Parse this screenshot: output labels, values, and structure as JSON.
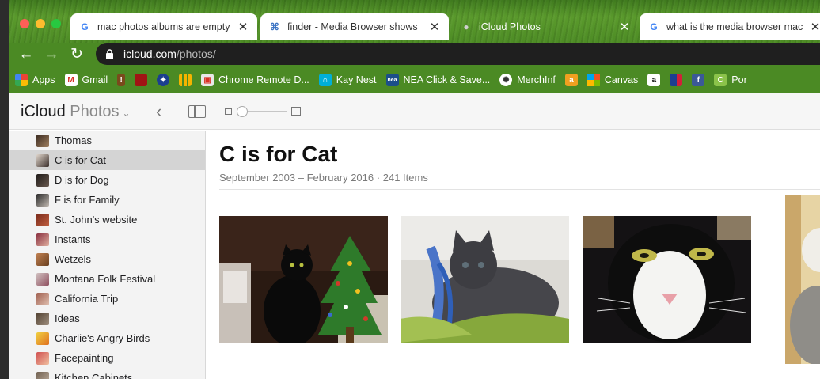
{
  "browser": {
    "tabs": [
      {
        "title": "mac photos albums are empty",
        "icon": "google-icon",
        "active": false
      },
      {
        "title": "finder - Media Browser shows",
        "icon": "stackexchange-icon",
        "active": false
      },
      {
        "title": "iCloud Photos",
        "icon": "apple-icon",
        "active": true
      },
      {
        "title": "what is the media browser mac",
        "icon": "google-icon",
        "active": false
      }
    ],
    "url_host": "icloud.com",
    "url_path": "/photos/",
    "bookmarks": [
      {
        "label": "Apps",
        "icon": "apps-grid-icon"
      },
      {
        "label": "Gmail",
        "icon": "gmail-icon"
      },
      {
        "label": "",
        "icon": "bookmark-icon"
      },
      {
        "label": "",
        "icon": "bookmark-icon"
      },
      {
        "label": "",
        "icon": "bookmark-icon"
      },
      {
        "label": "",
        "icon": "chart-icon"
      },
      {
        "label": "Chrome Remote D...",
        "icon": "chrome-remote-icon"
      },
      {
        "label": "Kay Nest",
        "icon": "nest-icon"
      },
      {
        "label": "NEA Click & Save...",
        "icon": "nea-icon"
      },
      {
        "label": "MerchInf",
        "icon": "merchinf-icon"
      },
      {
        "label": "",
        "icon": "amazon-icon"
      },
      {
        "label": "Canvas",
        "icon": "microsoft-icon"
      },
      {
        "label": "",
        "icon": "amazon-icon"
      },
      {
        "label": "",
        "icon": "mlb-icon"
      },
      {
        "label": "",
        "icon": "facebook-icon"
      },
      {
        "label": "Por",
        "icon": "c-icon"
      }
    ]
  },
  "app": {
    "brand_icloud": "iCloud",
    "brand_photos": "Photos",
    "brand_chevron": "⌄"
  },
  "sidebar": {
    "items": [
      {
        "label": "Thomas",
        "selected": false
      },
      {
        "label": "C is for Cat",
        "selected": true
      },
      {
        "label": "D is for Dog",
        "selected": false
      },
      {
        "label": "F is for Family",
        "selected": false
      },
      {
        "label": "St. John's website",
        "selected": false
      },
      {
        "label": "Instants",
        "selected": false
      },
      {
        "label": "Wetzels",
        "selected": false
      },
      {
        "label": "Montana Folk Festival",
        "selected": false
      },
      {
        "label": "California Trip",
        "selected": false
      },
      {
        "label": "Ideas",
        "selected": false
      },
      {
        "label": "Charlie's Angry Birds",
        "selected": false
      },
      {
        "label": "Facepainting",
        "selected": false
      },
      {
        "label": "Kitchen Cabinets",
        "selected": false
      }
    ]
  },
  "album": {
    "title": "C is for Cat",
    "date_range": "September 2003 – February 2016",
    "separator": "·",
    "item_count": "241 Items"
  }
}
